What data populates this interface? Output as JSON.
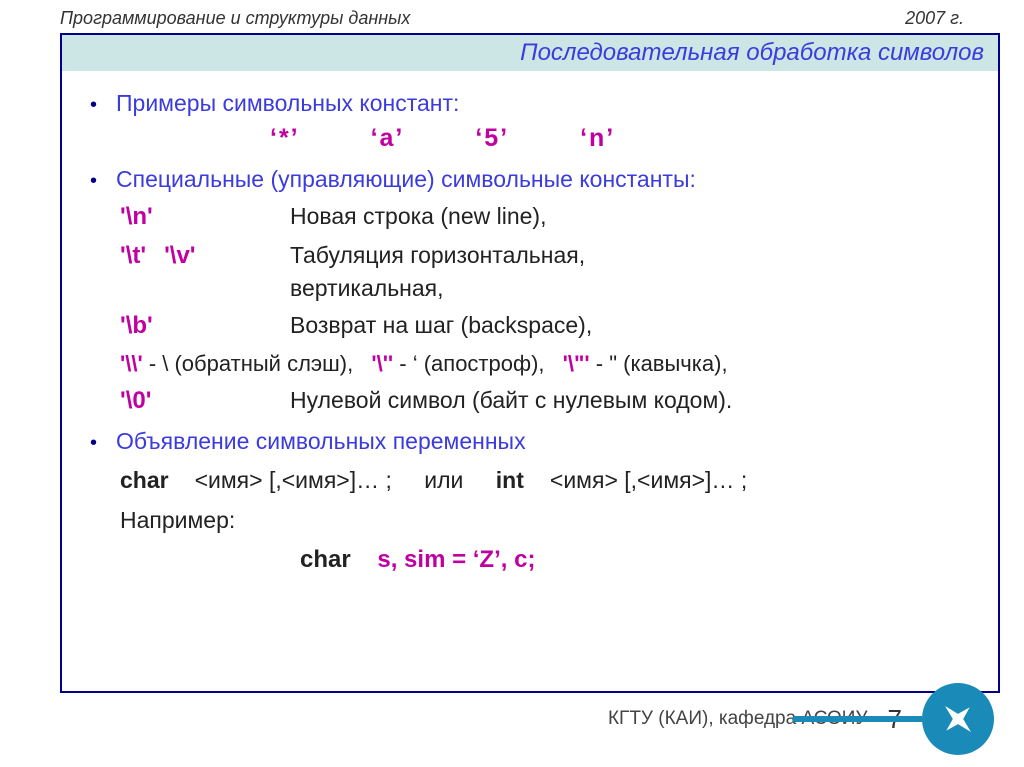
{
  "meta": {
    "course": "Программирование  и структуры данных",
    "year": "2007 г."
  },
  "title": "Последовательная обработка символов",
  "b1": "Примеры символьных констант:",
  "ex": {
    "e1": "‘*’",
    "e2": "‘a’",
    "e3": "‘5’",
    "e4": "‘n’"
  },
  "b2": "Специальные (управляющие) символьные константы:",
  "esc": {
    "r1c": "'\\n'",
    "r1d": "Новая строка (new line),",
    "r2c1": "'\\t'",
    "r2c2": "'\\v'",
    "r2d1": "Табуляция горизонтальная,",
    "r2d2": "вертикальная,",
    "r3c": "'\\b'",
    "r3d": "Возврат на шаг (backspace),",
    "r4a": "'\\\\'",
    "r4at": " -  \\ (обратный слэш),",
    "r4b": "'\\''",
    "r4bt": " - ‘ (апостроф),",
    "r4c": "'\\\"'",
    "r4ct": " - \"  (кавычка),",
    "r5c": "'\\0'",
    "r5d": "Нулевой символ (байт с нулевым кодом)."
  },
  "b3": "Объявление символьных переменных",
  "decl": {
    "lineA_char": "char",
    "lineA_mid": "<имя> [,<имя>]… ;",
    "lineA_or": "или",
    "lineA_int": "int",
    "lineA_end": "<имя> [,<имя>]… ;",
    "eg": "Например:",
    "final_kw": "char",
    "final_vars": "s,  sim = ‘Z’,   c;"
  },
  "footer": {
    "org": "КГТУ  (КАИ),  кафедра АСОИУ",
    "page": "7"
  }
}
